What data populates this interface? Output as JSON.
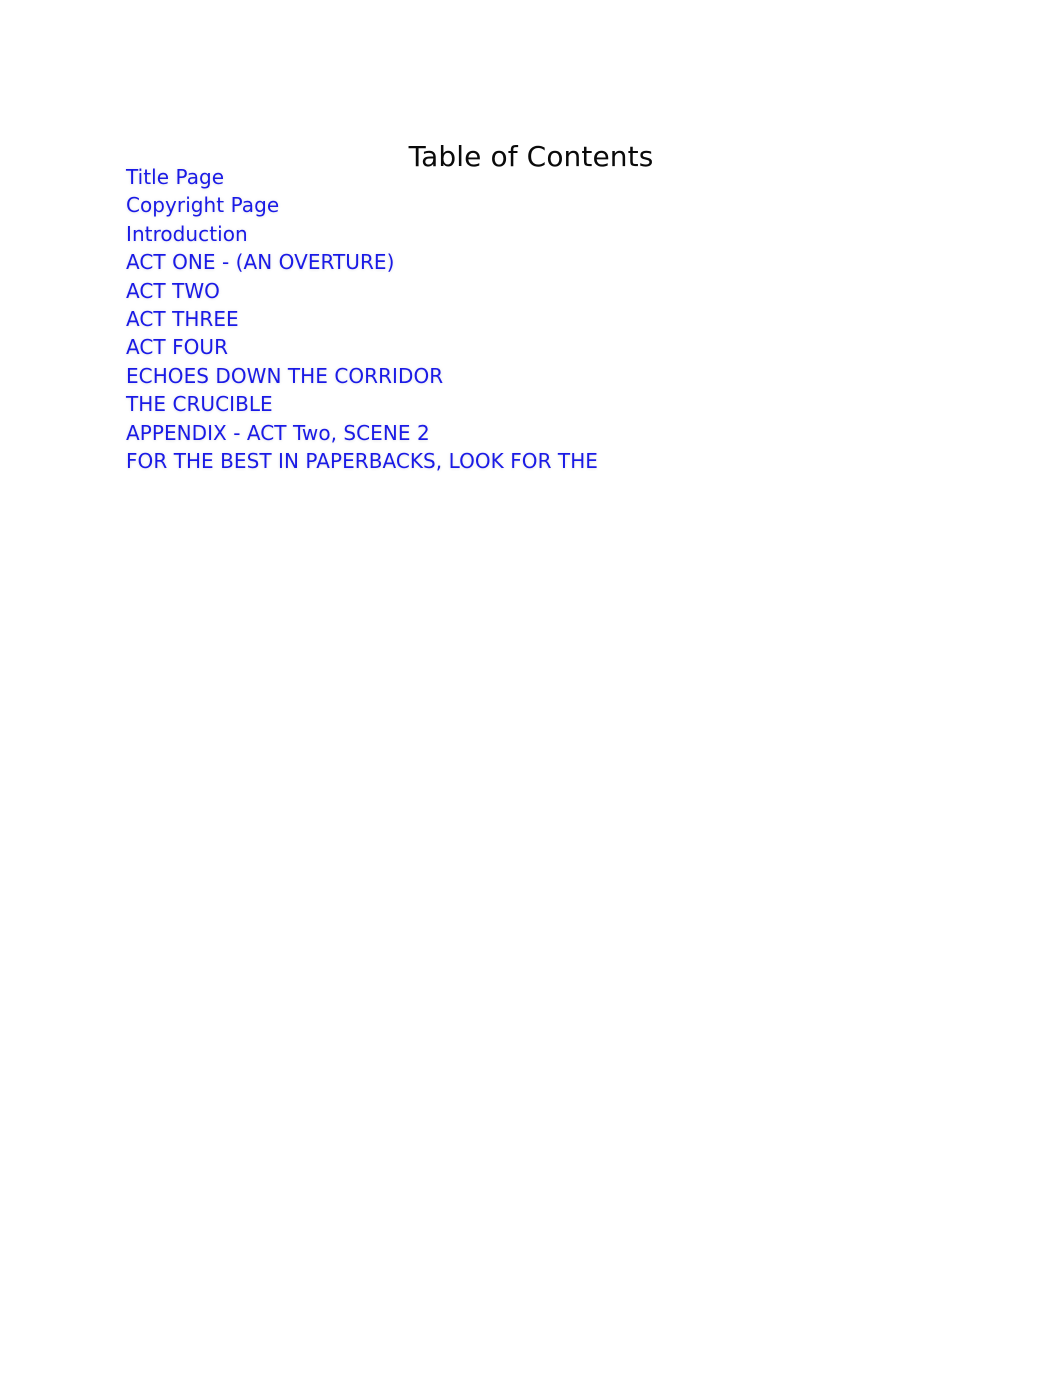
{
  "document": {
    "page_title": "Table of Contents",
    "background_color": "#ffffff",
    "title_color": "#0a0a0a",
    "link_color": "#1a1ae6"
  },
  "toc": {
    "heading": "Table of Contents",
    "entries": [
      {
        "label": "Title Page"
      },
      {
        "label": "Copyright Page"
      },
      {
        "label": "Introduction"
      },
      {
        "label": "ACT ONE - (AN OVERTURE)"
      },
      {
        "label": "ACT TWO"
      },
      {
        "label": "ACT THREE"
      },
      {
        "label": "ACT FOUR"
      },
      {
        "label": "ECHOES DOWN THE CORRIDOR"
      },
      {
        "label": "THE CRUCIBLE"
      },
      {
        "label": "APPENDIX - ACT Two, SCENE 2"
      },
      {
        "label": "FOR THE BEST IN PAPERBACKS, LOOK FOR THE"
      }
    ]
  }
}
